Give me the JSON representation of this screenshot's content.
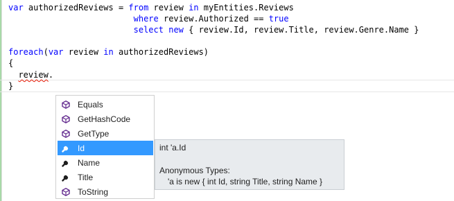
{
  "code": {
    "line1": {
      "p1_kw": "var",
      "p2": " authorizedReviews = ",
      "p3_kw": "from",
      "p4": " review ",
      "p5_kw": "in",
      "p6": " myEntities.Reviews"
    },
    "line2": {
      "indent": "                         ",
      "p1_kw": "where",
      "p2": " review.Authorized == ",
      "p3_kw": "true"
    },
    "line3": {
      "indent": "                         ",
      "p1_kw": "select",
      "p2": " ",
      "p3_kw": "new",
      "p4": " { review.Id, review.Title, review.Genre.Name }"
    },
    "line5": {
      "p1_kw": "foreach",
      "p2": "(",
      "p3_kw": "var",
      "p4": " review ",
      "p5_kw": "in",
      "p6": " authorizedReviews)"
    },
    "line6": "{",
    "line7": {
      "indent": "  ",
      "ident": "review",
      "dot": "."
    },
    "line8": "}"
  },
  "completion": {
    "items": [
      {
        "label": "Equals",
        "icon": "method-icon"
      },
      {
        "label": "GetHashCode",
        "icon": "method-icon"
      },
      {
        "label": "GetType",
        "icon": "method-icon"
      },
      {
        "label": "Id",
        "icon": "property-icon",
        "selected": true
      },
      {
        "label": "Name",
        "icon": "property-icon"
      },
      {
        "label": "Title",
        "icon": "property-icon"
      },
      {
        "label": "ToString",
        "icon": "method-icon"
      }
    ]
  },
  "tooltip": {
    "signature": "int 'a.Id",
    "heading": "Anonymous Types:",
    "description": "'a is new { int Id, string Title, string Name }"
  },
  "colors": {
    "keyword": "#0000ff",
    "selection": "#3399ff",
    "tooltip_bg": "#e8ebee",
    "method_icon": "#652d90"
  }
}
